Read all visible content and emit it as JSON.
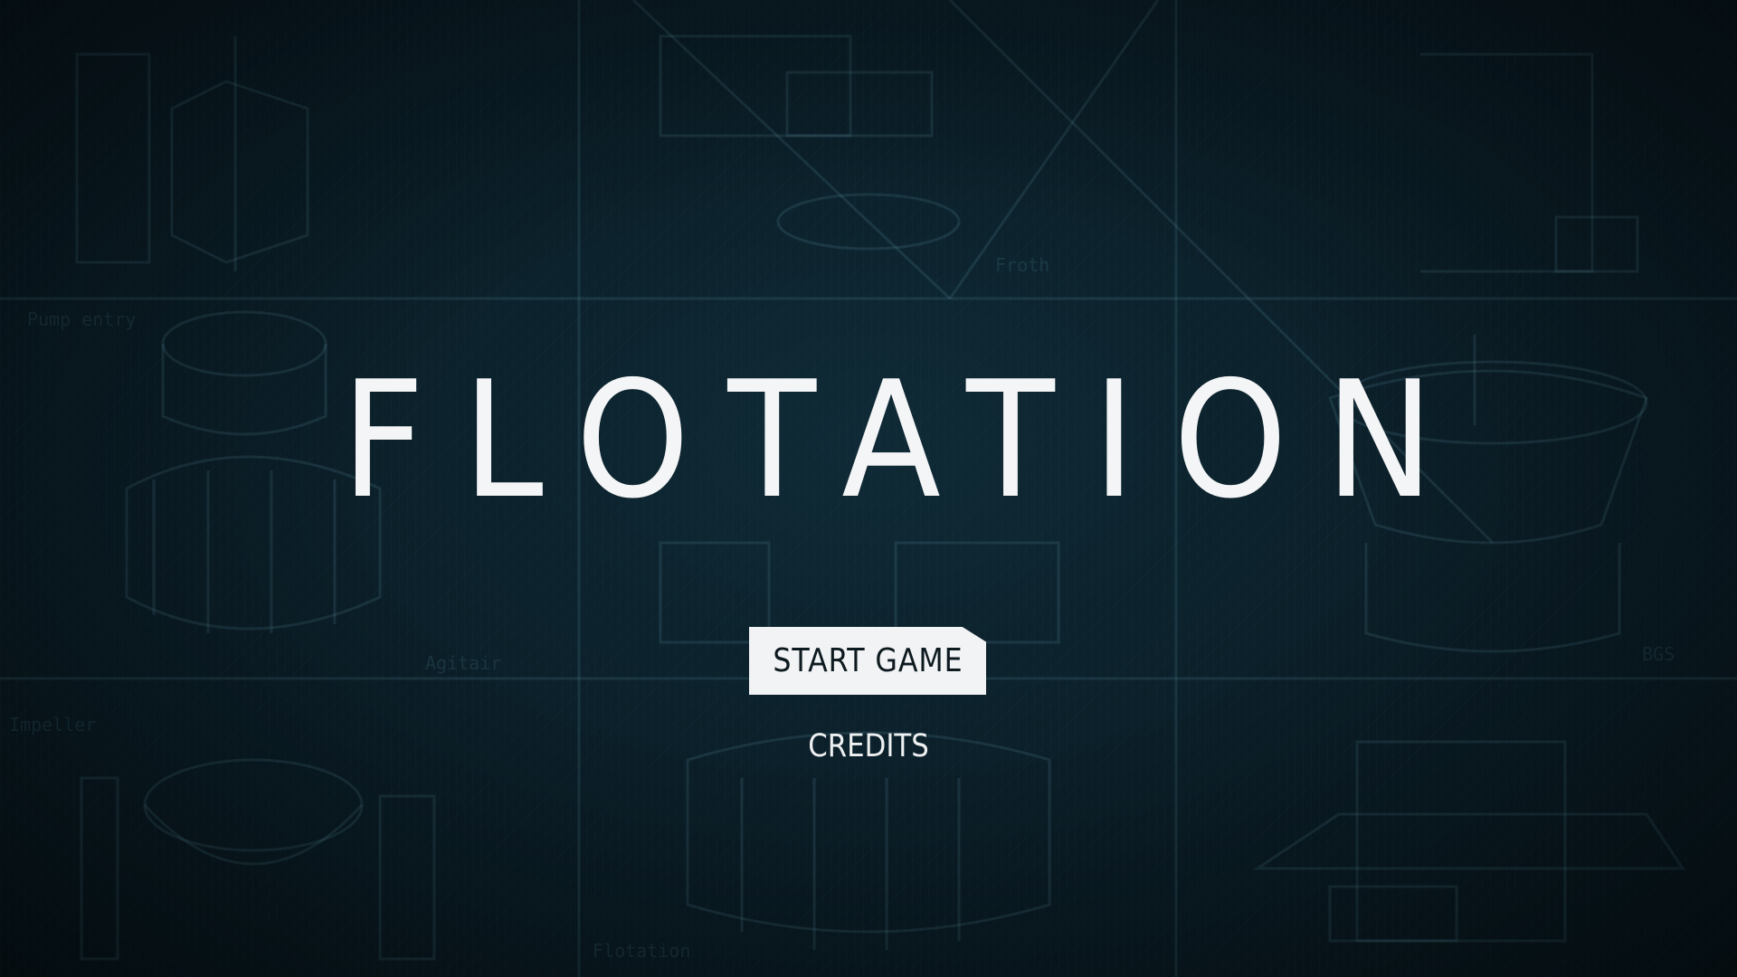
{
  "game": {
    "title": "FLOTATION"
  },
  "menu": {
    "start_label": "START GAME",
    "credits_label": "CREDITS"
  },
  "background": {
    "sketch_labels": [
      "Agitair",
      "Impeller",
      "Pump entry",
      "Flotation",
      "Froth",
      "BGS"
    ]
  },
  "colors": {
    "background": "#0b1f29",
    "text": "#f4f5f6",
    "button_bg": "#f2f3f4",
    "button_text": "#0d1a20"
  }
}
